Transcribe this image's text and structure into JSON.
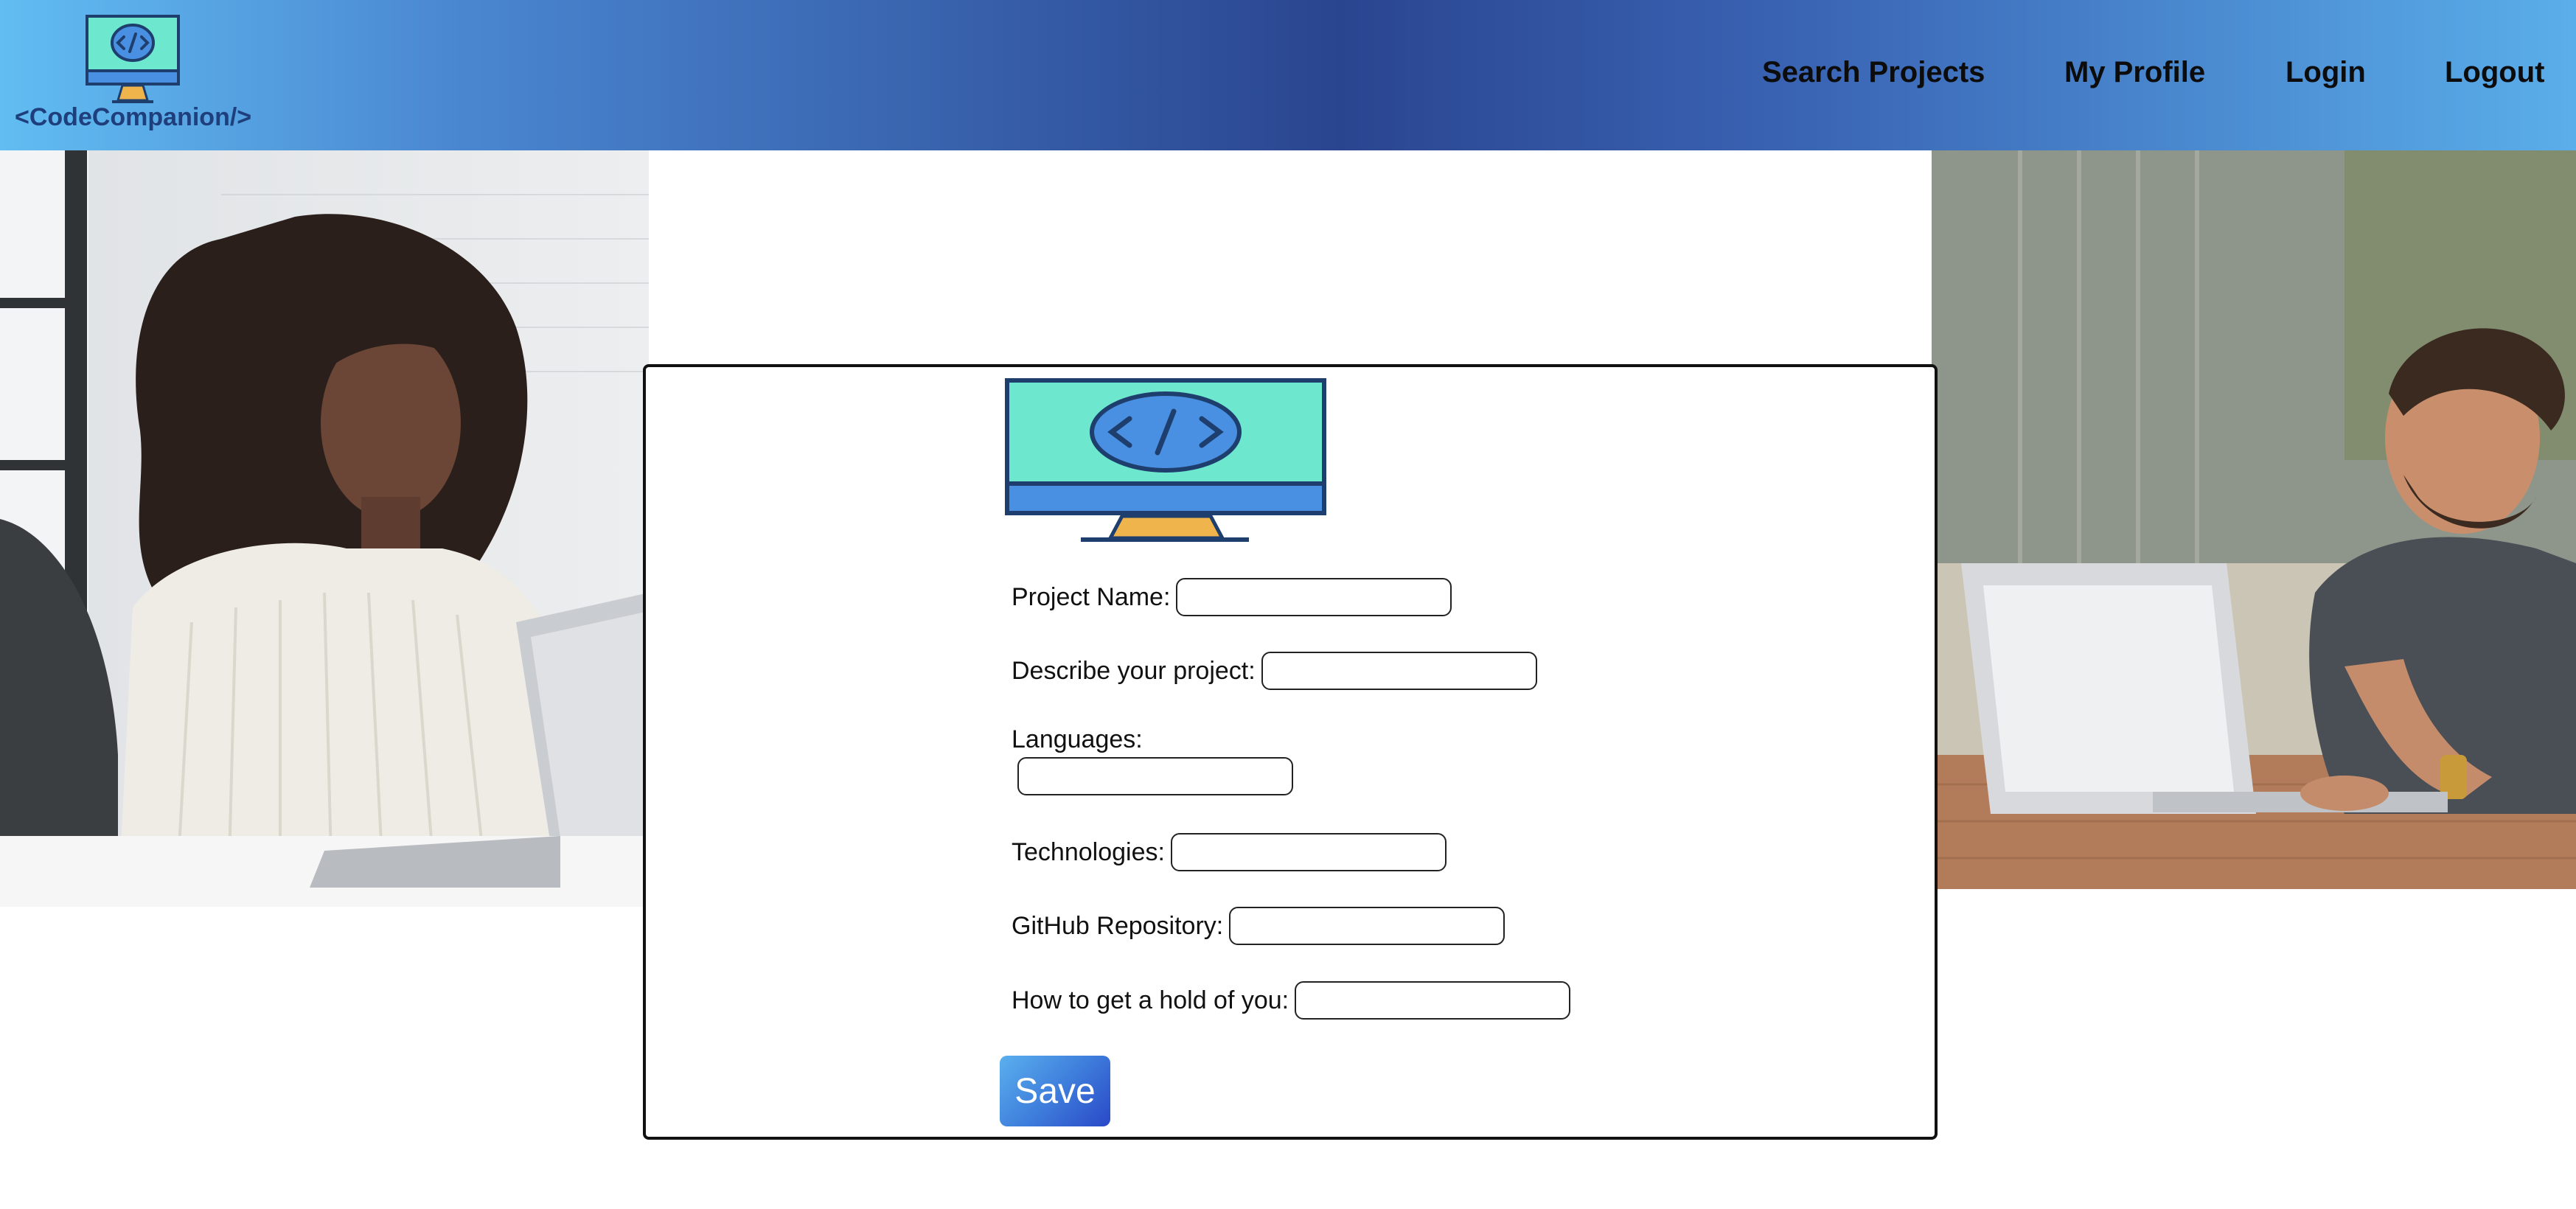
{
  "header": {
    "brand_text": "<CodeCompanion/>",
    "nav": {
      "search_projects": "Search Projects",
      "my_profile": "My Profile",
      "login": "Login",
      "logout": "Logout"
    }
  },
  "form": {
    "project_name": {
      "label": "Project Name:",
      "value": ""
    },
    "description": {
      "label": "Describe your project:",
      "value": ""
    },
    "languages": {
      "label": "Languages:",
      "value": ""
    },
    "technologies": {
      "label": "Technologies:",
      "value": ""
    },
    "github": {
      "label": "GitHub Repository:",
      "value": ""
    },
    "contact": {
      "label": "How to get a hold of you:",
      "value": ""
    },
    "save_label": "Save"
  },
  "icons": [
    "monitor-code-logo-icon"
  ],
  "colors": {
    "header_gradient_edge": "#61bdf2",
    "header_gradient_center": "#2a4590",
    "logo_screen": "#6ee7cf",
    "logo_frame": "#1e3f6e",
    "logo_accent": "#4a90e2",
    "logo_stand": "#f0b44c",
    "save_gradient_start": "#5ab0ee",
    "save_gradient_end": "#2a48c8"
  }
}
